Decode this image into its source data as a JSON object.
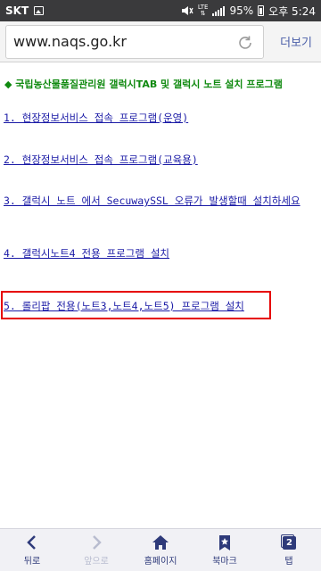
{
  "status_bar": {
    "carrier": "SKT",
    "network": "LTE",
    "battery": "95%",
    "time": "오후 5:24"
  },
  "address_bar": {
    "url": "www.naqs.go.kr",
    "more_label": "더보기"
  },
  "content": {
    "heading": "◆ 국립농산물품질관리원 갤럭시TAB 및 갤럭시 노트 설치 프로그램",
    "links": [
      "1. 현장정보서비스 접속 프로그램(운영)",
      "2. 현장정보서비스 접속 프로그램(교육용)",
      "3. 갤럭시 노트 에서 SecuwaySSL 오류가 발생할때 설치하세요",
      "4. 갤럭시노트4 전용 프로그램 설치",
      "5. 롤리팝 전용(노트3,노트4,노트5) 프로그램 설치"
    ]
  },
  "bottom_nav": {
    "back": "뒤로",
    "forward": "앞으로",
    "home": "홈페이지",
    "bookmarks": "북마크",
    "tabs": "탭",
    "tab_count": "2"
  },
  "colors": {
    "heading": "#108a10",
    "link": "#1a1aa6",
    "highlight": "#e60000",
    "nav": "#2e3a7a"
  }
}
